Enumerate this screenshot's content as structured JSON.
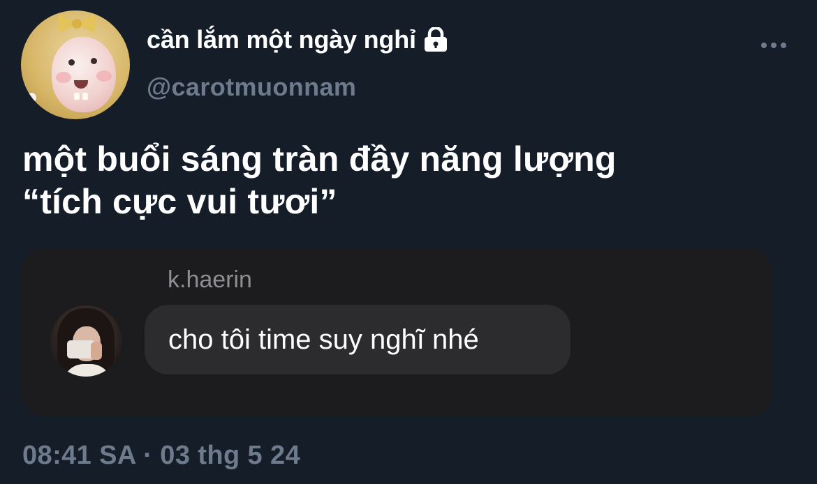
{
  "tweet": {
    "display_name": "cần lắm một ngày nghỉ",
    "handle": "@carotmuonnam",
    "text_line1": "một buổi sáng tràn đầy năng lượng",
    "text_line2": "“tích cực vui tươi”",
    "timestamp": "08:41 SA · 03 thg 5 24",
    "protected_icon": "lock-icon",
    "more_icon": "more-horizontal-icon"
  },
  "attachment": {
    "reply_username": "k.haerin",
    "reply_message": "cho tôi time suy nghĩ nhé"
  },
  "colors": {
    "background": "#151d29",
    "primary_text": "#ffffff",
    "secondary_text": "#6e7b8d",
    "card_background": "#1c1c1e",
    "bubble_background": "#2c2c2e"
  }
}
